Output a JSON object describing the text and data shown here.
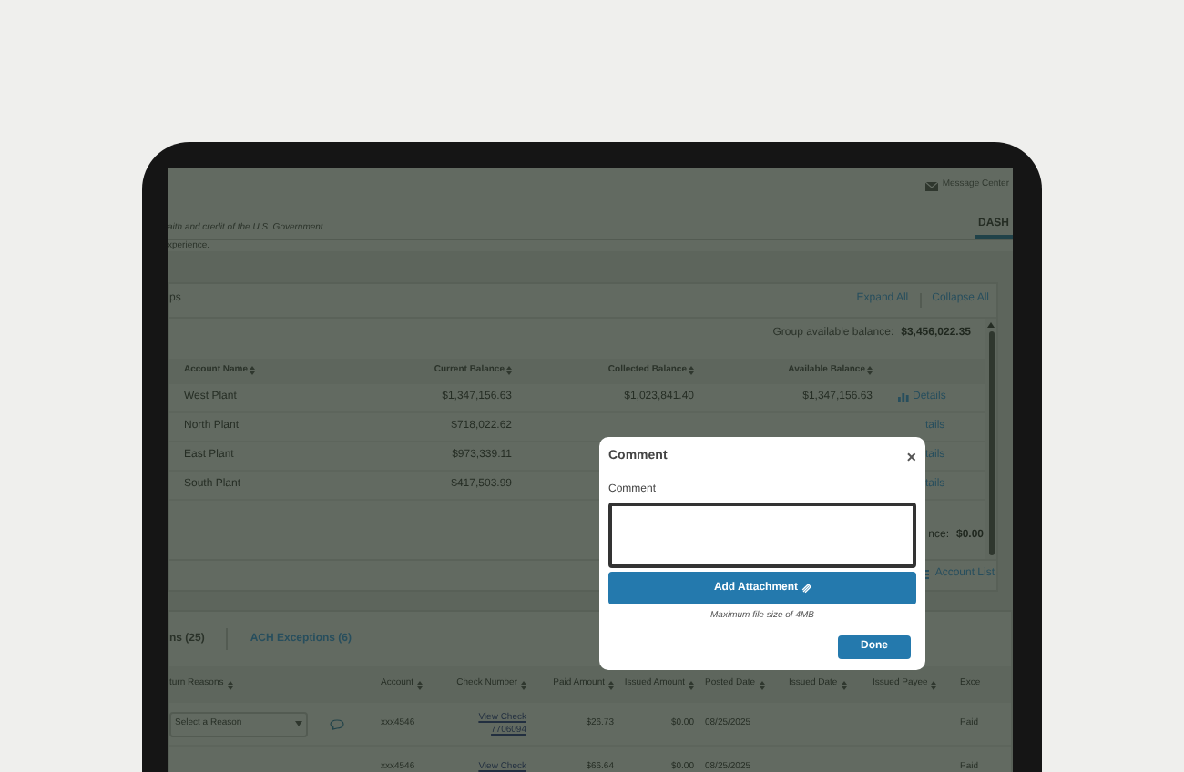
{
  "header": {
    "message_center": "Message Center",
    "tagline": "aith and credit of the U.S. Government",
    "subtitle": "xperience.",
    "tab": {
      "label": "DASH",
      "selected": true
    }
  },
  "balances_panel": {
    "title": "ps",
    "actions": [
      "Expand All",
      "Collapse All"
    ],
    "group_balance_label": "Group available balance:",
    "group_balance": "$3,456,022.35",
    "columns": [
      "Account Name",
      "Current Balance",
      "Collected Balance",
      "Available Balance"
    ],
    "rows": [
      {
        "account_name": "West Plant",
        "current_balance": "$1,347,156.63",
        "collected_balance": "$1,023,841.40",
        "available_balance": "$1,347,156.63",
        "details": "Details",
        "details_icon": true
      },
      {
        "account_name": "North Plant",
        "current_balance": "$718,022.62",
        "details": "tails",
        "details_icon": false
      },
      {
        "account_name": "East Plant",
        "current_balance": "$973,339.11",
        "details": "tails",
        "details_icon": false
      },
      {
        "account_name": "South Plant",
        "current_balance": "$417,503.99",
        "details": "tails",
        "details_icon": false
      }
    ],
    "footer_balance_label": "nce:",
    "footer_balance": "$0.00",
    "account_list": "Account List"
  },
  "exceptions_panel": {
    "tabs": [
      {
        "label": "ns (25)",
        "selected": true
      },
      {
        "label": "ACH Exceptions (6)",
        "selected": false
      }
    ],
    "columns": [
      "turn Reasons",
      "",
      "Account",
      "Check Number",
      "Paid Amount",
      "Issued Amount",
      "Posted Date",
      "Issued Date",
      "Issued Payee",
      "Exce"
    ],
    "rows": [
      {
        "reason_placeholder": "Select a Reason",
        "account": "xxx4546",
        "check_link": "View Check",
        "check_number": "7706094",
        "paid_amount": "$26.73",
        "issued_amount": "$0.00",
        "posted_date": "08/25/2025",
        "status": "Paid"
      },
      {
        "reason_placeholder": "",
        "account": "xxx4546",
        "check_link": "View Check",
        "check_number": "",
        "paid_amount": "$66.64",
        "issued_amount": "$0.00",
        "posted_date": "08/25/2025",
        "status": "Paid"
      }
    ]
  },
  "modal": {
    "title": "Comment",
    "close": "×",
    "field_label": "Comment",
    "attach_button": "Add Attachment",
    "hint": "Maximum file size of 4MB",
    "done_button": "Done"
  }
}
